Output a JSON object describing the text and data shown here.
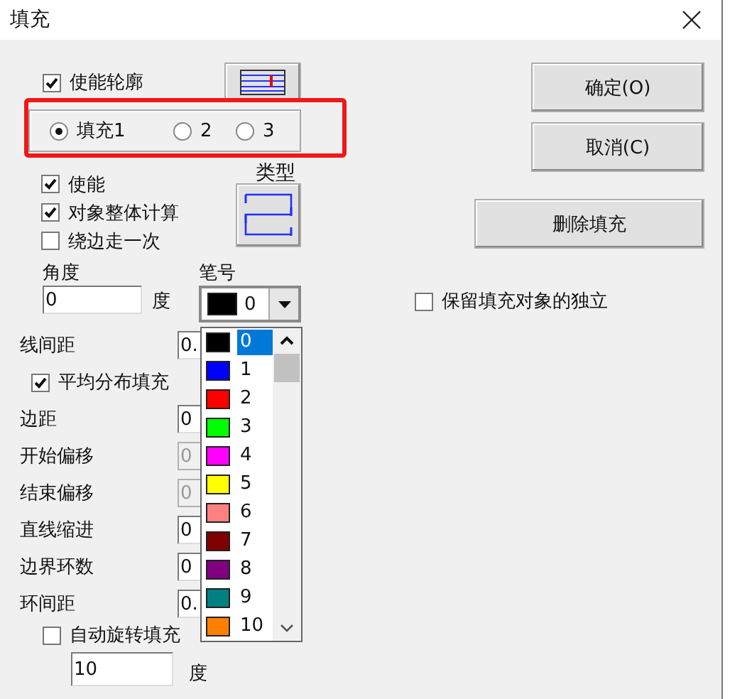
{
  "window": {
    "title": "填充"
  },
  "outline": {
    "label": "使能轮廓",
    "checked": true
  },
  "fill_radios": [
    {
      "label": "填充1",
      "selected": true
    },
    {
      "label": "2",
      "selected": false
    },
    {
      "label": "3",
      "selected": false
    }
  ],
  "options": [
    {
      "label": "使能",
      "checked": true
    },
    {
      "label": "对象整体计算",
      "checked": true
    },
    {
      "label": "绕边走一次",
      "checked": false
    }
  ],
  "type_label": "类型",
  "angle": {
    "label": "角度",
    "value": "0",
    "unit": "度"
  },
  "pen": {
    "label": "笔号",
    "value": "0",
    "color": "#000000"
  },
  "pen_list": [
    {
      "label": "0",
      "color": "#000000",
      "selected": true
    },
    {
      "label": "1",
      "color": "#0000ff",
      "selected": false
    },
    {
      "label": "2",
      "color": "#ff0000",
      "selected": false
    },
    {
      "label": "3",
      "color": "#00ff00",
      "selected": false
    },
    {
      "label": "4",
      "color": "#ff00ff",
      "selected": false
    },
    {
      "label": "5",
      "color": "#ffff00",
      "selected": false
    },
    {
      "label": "6",
      "color": "#ff8080",
      "selected": false
    },
    {
      "label": "7",
      "color": "#800000",
      "selected": false
    },
    {
      "label": "8",
      "color": "#800080",
      "selected": false
    },
    {
      "label": "9",
      "color": "#008080",
      "selected": false
    },
    {
      "label": "10",
      "color": "#ff8000",
      "selected": false
    }
  ],
  "params": [
    {
      "kind": "field",
      "label": "线间距",
      "value": "0.",
      "disabled": false
    },
    {
      "kind": "check",
      "label": "平均分布填充",
      "checked": true
    },
    {
      "kind": "field",
      "label": "边距",
      "value": "0",
      "disabled": false
    },
    {
      "kind": "field",
      "label": "开始偏移",
      "value": "0",
      "disabled": true
    },
    {
      "kind": "field",
      "label": "结束偏移",
      "value": "0",
      "disabled": true
    },
    {
      "kind": "field",
      "label": "直线缩进",
      "value": "0",
      "disabled": false
    },
    {
      "kind": "field",
      "label": "边界环数",
      "value": "0",
      "disabled": false
    },
    {
      "kind": "field",
      "label": "环间距",
      "value": "0.",
      "disabled": false
    }
  ],
  "auto_rotate": {
    "label": "自动旋转填充",
    "checked": false,
    "value": "10",
    "unit": "度"
  },
  "buttons": [
    {
      "label": "确定(O)"
    },
    {
      "label": "取消(C)"
    }
  ],
  "delete_button": "删除填充",
  "keep_independent": {
    "label": "保留填充对象的独立",
    "checked": false
  }
}
